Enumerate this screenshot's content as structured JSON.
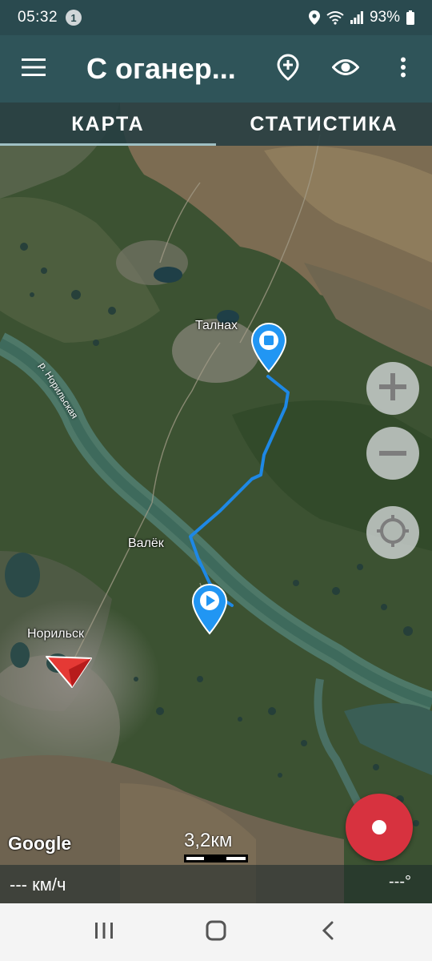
{
  "status": {
    "time": "05:32",
    "notification_count": "1",
    "battery": "93%"
  },
  "appbar": {
    "title": "С оганер...",
    "icons": [
      "menu-icon",
      "add-location-icon",
      "eye-icon",
      "more-vert-icon"
    ]
  },
  "tabs": [
    {
      "label": "КАРТА",
      "active": true
    },
    {
      "label": "СТАТИСТИКА",
      "active": false
    }
  ],
  "map": {
    "labels": {
      "talnakh": "Талнах",
      "valek": "Валёк",
      "norilsk": "Норильск",
      "river": "р. Норильская"
    },
    "track_color": "#1e88e5",
    "start_marker": "play-marker-icon",
    "end_marker": "stop-marker-icon",
    "position_marker": "navigation-arrow-icon",
    "attribution": "Google",
    "scale": "3,2км"
  },
  "controls": {
    "zoom_in": "plus-icon",
    "zoom_out": "minus-icon",
    "locate": "target-icon",
    "record": "record-icon",
    "record_color": "#d7323f"
  },
  "info": {
    "speed": "--- км/ч",
    "bearing": "---°"
  },
  "navbar": {
    "icons": [
      "recents-icon",
      "home-icon",
      "back-icon"
    ]
  }
}
